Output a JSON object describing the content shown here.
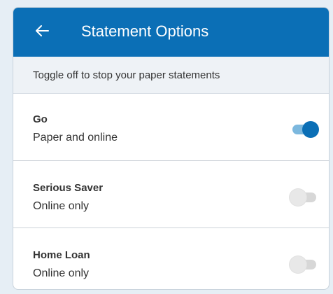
{
  "header": {
    "title": "Statement Options",
    "back_icon": "arrow-left-icon"
  },
  "subheader": {
    "text": "Toggle off to stop your paper statements"
  },
  "accounts": [
    {
      "name": "Go",
      "status": "Paper and online",
      "paper_statements": true
    },
    {
      "name": "Serious Saver",
      "status": "Online only",
      "paper_statements": false
    },
    {
      "name": "Home Loan",
      "status": "Online only",
      "paper_statements": false
    }
  ],
  "colors": {
    "header_bg": "#0b6fb6",
    "toggle_on_track": "#7cb8de",
    "toggle_on_knob": "#0b6fb6",
    "toggle_off_track": "#d7d7d7",
    "toggle_off_knob": "#e8e8e8"
  }
}
